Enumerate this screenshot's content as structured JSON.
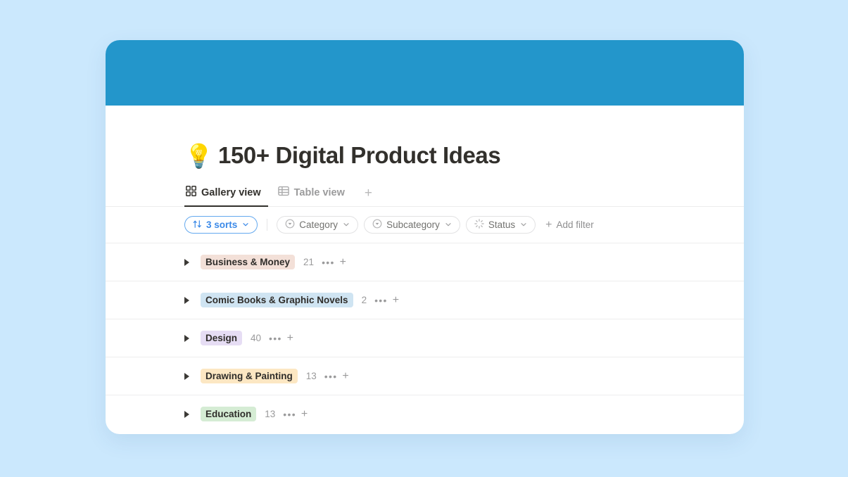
{
  "theme": {
    "page_background": "#cbe8fd",
    "cover_color": "#2396cb",
    "card_background": "#ffffff",
    "accent_blue": "#3c8ae8",
    "title_color": "#32302c"
  },
  "header": {
    "emoji": "💡",
    "emoji_name": "light-bulb",
    "title": "150+ Digital Product Ideas"
  },
  "view_tabs": {
    "add_label": "+",
    "items": [
      {
        "label": "Gallery view",
        "icon": "gallery-grid-icon",
        "active": true
      },
      {
        "label": "Table view",
        "icon": "table-grid-icon",
        "active": false
      }
    ]
  },
  "toolbar": {
    "sorts": {
      "label": "3 sorts",
      "icon": "sort-arrows-icon",
      "chevron": "˅"
    },
    "filters": [
      {
        "label": "Category",
        "icon": "single-select-icon",
        "chevron": "˅"
      },
      {
        "label": "Subcategory",
        "icon": "single-select-icon",
        "chevron": "˅"
      },
      {
        "label": "Status",
        "icon": "status-spinner-icon",
        "chevron": "˅"
      }
    ],
    "add_filter": {
      "label": "Add filter",
      "plus": "+"
    }
  },
  "groups": {
    "more_glyph": "•••",
    "add_glyph": "+",
    "rows": [
      {
        "label": "Business & Money",
        "count": "21",
        "badge_bg": "#f3e0d8",
        "badge_color": "#2f2d2a"
      },
      {
        "label": "Comic Books & Graphic Novels",
        "count": "2",
        "badge_bg": "#cfe4f2",
        "badge_color": "#2f2d2a"
      },
      {
        "label": "Design",
        "count": "40",
        "badge_bg": "#e6ddf4",
        "badge_color": "#2f2d2a"
      },
      {
        "label": "Drawing & Painting",
        "count": "13",
        "badge_bg": "#fce7c3",
        "badge_color": "#2f2d2a"
      },
      {
        "label": "Education",
        "count": "13",
        "badge_bg": "#d5ecd4",
        "badge_color": "#2f2d2a"
      }
    ]
  }
}
